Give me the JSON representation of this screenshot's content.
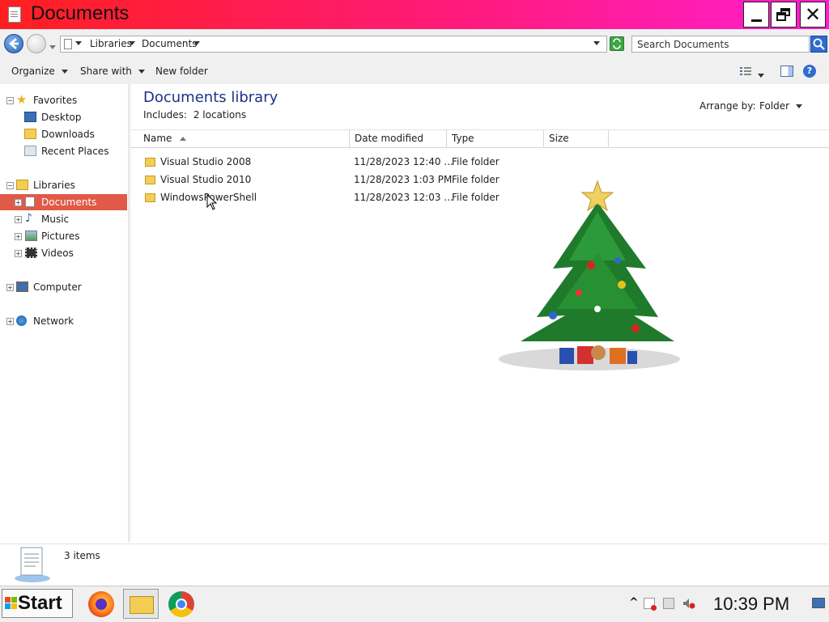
{
  "window": {
    "title": "Documents",
    "min_glyph": "▁",
    "max_glyph": "❐",
    "close_glyph": "✕"
  },
  "address": {
    "crumbs": [
      "Libraries",
      "Documents"
    ],
    "search_placeholder": "Search Documents"
  },
  "toolbar": {
    "organize": "Organize",
    "share_with": "Share with",
    "new_folder": "New folder",
    "help_glyph": "?"
  },
  "nav": {
    "favorites": "Favorites",
    "desktop": "Desktop",
    "downloads": "Downloads",
    "recent_places": "Recent Places",
    "libraries": "Libraries",
    "documents": "Documents",
    "music": "Music",
    "pictures": "Pictures",
    "videos": "Videos",
    "computer": "Computer",
    "network": "Network"
  },
  "library": {
    "title": "Documents library",
    "includes_label": "Includes:",
    "includes_value": "2 locations",
    "arrange_label": "Arrange by:",
    "arrange_value": "Folder"
  },
  "columns": {
    "name": "Name",
    "date_modified": "Date modified",
    "type": "Type",
    "size": "Size"
  },
  "files": [
    {
      "name": "Visual Studio 2008",
      "date": "11/28/2023 12:40 ...",
      "type": "File folder"
    },
    {
      "name": "Visual Studio 2010",
      "date": "11/28/2023 1:03 PM",
      "type": "File folder"
    },
    {
      "name": "WindowsPowerShell",
      "date": "11/28/2023 12:03 ...",
      "type": "File folder"
    }
  ],
  "status": {
    "items": "3 items"
  },
  "taskbar": {
    "start": "Start",
    "clock": "10:39 PM",
    "tray_expand": "^"
  },
  "colors": {
    "title_gradient_start": "#ff1f1f",
    "title_gradient_end": "#ff1fd0",
    "selection": "#e05a47"
  }
}
